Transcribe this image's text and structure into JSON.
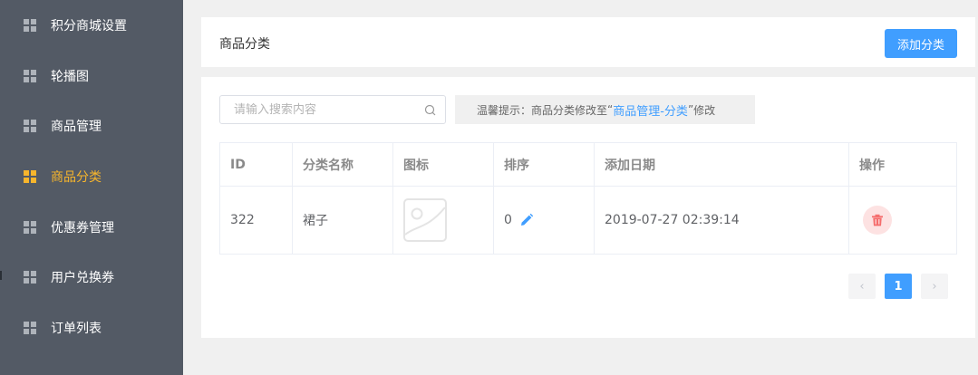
{
  "sidebar": {
    "items": [
      {
        "label": "积分商城设置",
        "icon": "grid-icon",
        "active": false
      },
      {
        "label": "轮播图",
        "icon": "grid-icon",
        "active": false
      },
      {
        "label": "商品管理",
        "icon": "grid-icon",
        "active": false
      },
      {
        "label": "商品分类",
        "icon": "grid-icon",
        "active": true
      },
      {
        "label": "优惠券管理",
        "icon": "grid-icon",
        "active": false
      },
      {
        "label": "用户兑换券",
        "icon": "grid-icon",
        "active": false
      },
      {
        "label": "订单列表",
        "icon": "grid-icon",
        "active": false
      }
    ]
  },
  "header": {
    "title": "商品分类",
    "add_button_label": "添加分类"
  },
  "search": {
    "placeholder": "请输入搜索内容",
    "value": ""
  },
  "tip": {
    "prefix": "温馨提示：商品分类修改至",
    "open_quote": "“",
    "link": "商品管理-分类",
    "close_quote": "”",
    "suffix": "修改"
  },
  "table": {
    "columns": [
      "ID",
      "分类名称",
      "图标",
      "排序",
      "添加日期",
      "操作"
    ],
    "rows": [
      {
        "id": "322",
        "name": "裙子",
        "icon": "image-placeholder-icon",
        "sort": "0",
        "date": "2019-07-27 02:39:14"
      }
    ]
  },
  "pagination": {
    "prev": "‹",
    "current_page": "1",
    "next": "›"
  },
  "colors": {
    "sidebar_bg": "#535a65",
    "active": "#f7b52c",
    "primary": "#409eff",
    "danger": "#f56c6c",
    "danger_bg": "#fde2e2"
  }
}
